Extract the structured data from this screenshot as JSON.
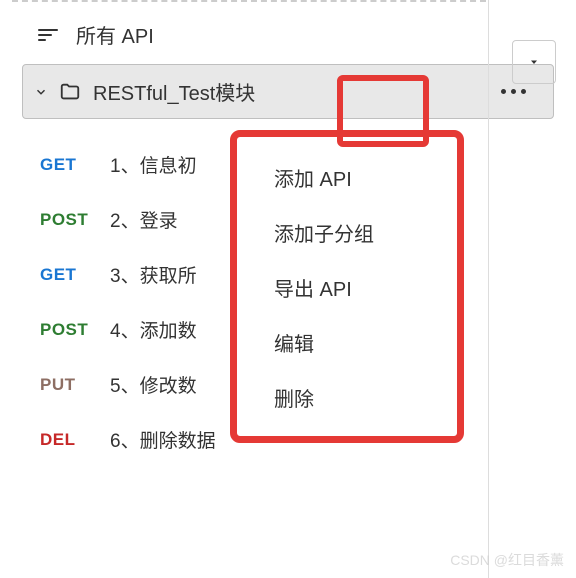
{
  "header": {
    "title": "所有 API"
  },
  "folder": {
    "name": "RESTful_Test模块"
  },
  "apis": [
    {
      "method": "GET",
      "methodClass": "get",
      "label": "1、信息初"
    },
    {
      "method": "POST",
      "methodClass": "post",
      "label": "2、登录"
    },
    {
      "method": "GET",
      "methodClass": "get",
      "label": "3、获取所"
    },
    {
      "method": "POST",
      "methodClass": "post",
      "label": "4、添加数"
    },
    {
      "method": "PUT",
      "methodClass": "put",
      "label": "5、修改数"
    },
    {
      "method": "DEL",
      "methodClass": "del",
      "label": "6、删除数据"
    }
  ],
  "contextMenu": [
    "添加 API",
    "添加子分组",
    "导出 API",
    "编辑",
    "删除"
  ],
  "watermark": "CSDN @红目香薰"
}
